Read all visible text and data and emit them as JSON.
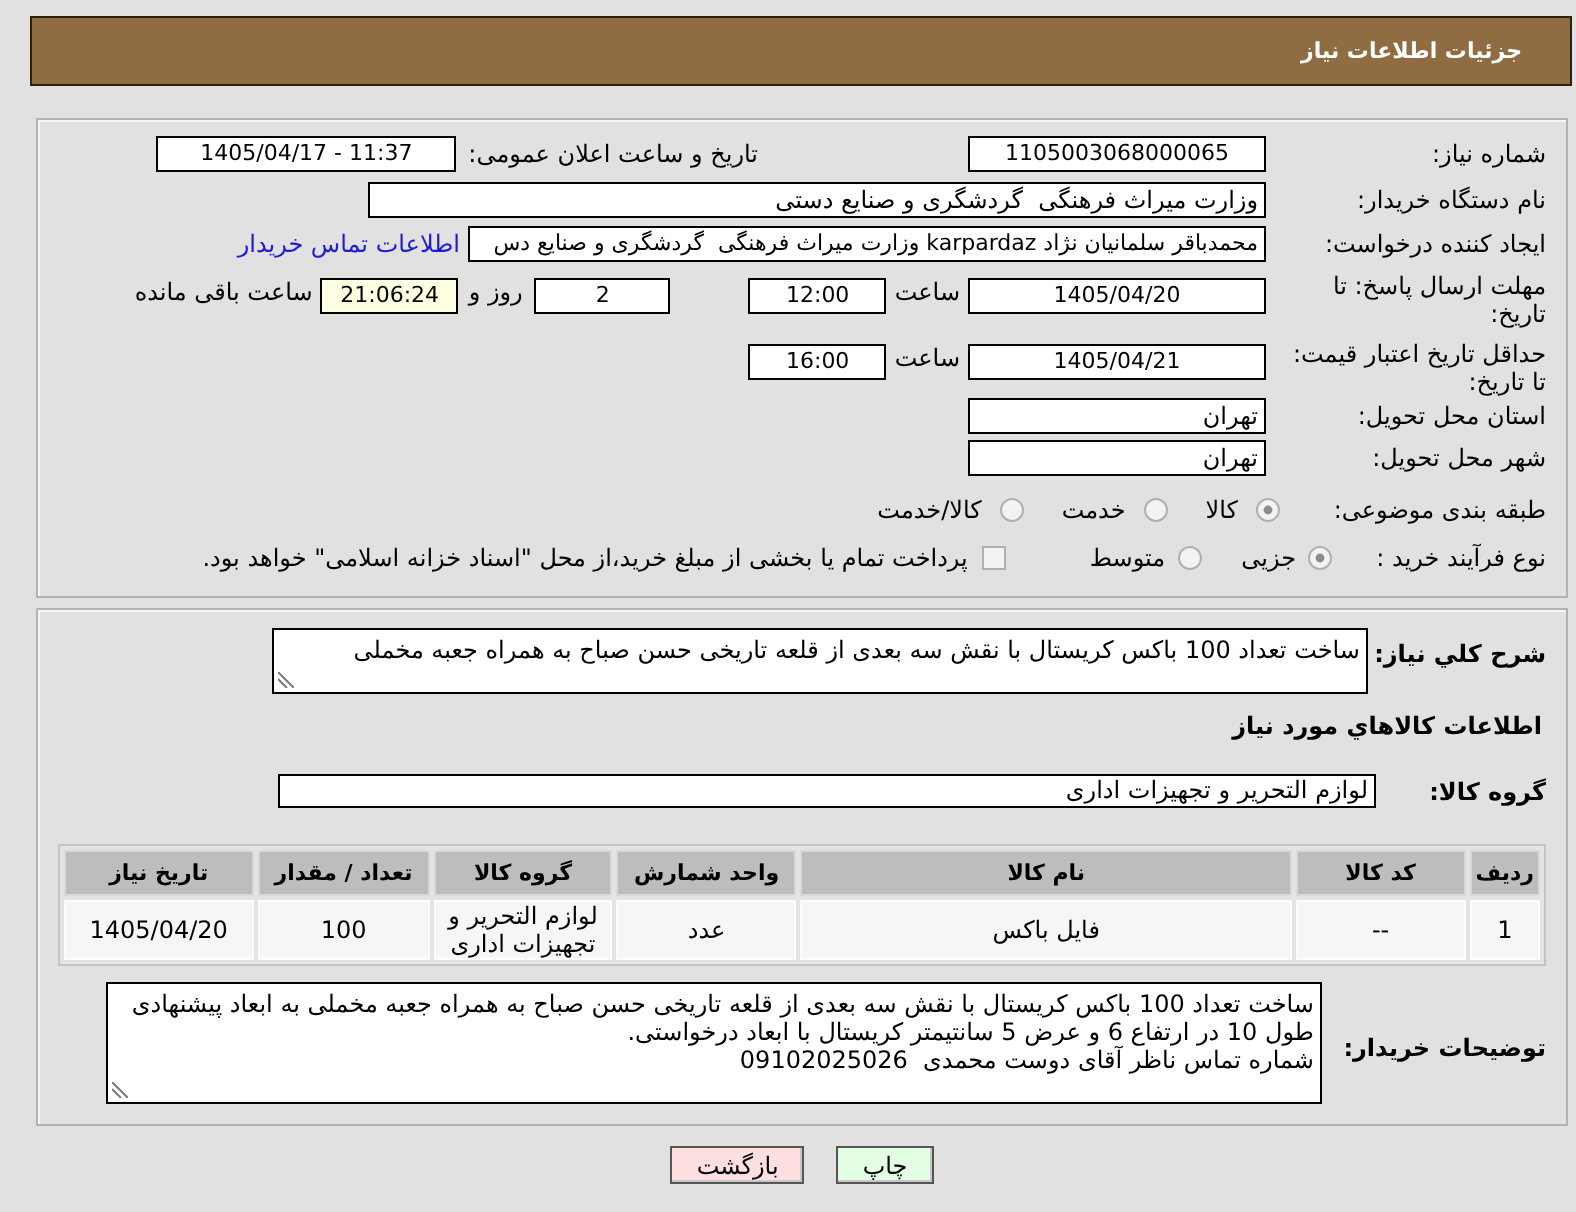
{
  "header": {
    "title": "جزئیات اطلاعات نیاز"
  },
  "need_info": {
    "need_number": {
      "label": "شماره نیاز:",
      "value": "1105003068000065"
    },
    "announce_date": {
      "label": "تاریخ و ساعت اعلان عمومی:",
      "value": "1405/04/17 - 11:37"
    },
    "buyer_org": {
      "label": "نام دستگاه خریدار:",
      "value": "وزارت میراث فرهنگی  گردشگری و صنایع دستی"
    },
    "requester": {
      "label": "ایجاد کننده درخواست:",
      "value": "محمدباقر سلمانیان نژاد karpardaz وزارت میراث فرهنگی  گردشگری و صنایع دس",
      "contact_link": "اطلاعات تماس خریدار"
    },
    "response_deadline": {
      "label": "مهلت ارسال پاسخ: تا تاریخ:",
      "date": "1405/04/20",
      "time_label": "ساعت",
      "time": "12:00",
      "days": "2",
      "days_label": "روز و",
      "remaining_time": "21:06:24",
      "remaining_label": "ساعت باقی مانده"
    },
    "price_validity": {
      "label": "حداقل تاریخ اعتبار قیمت: تا تاریخ:",
      "date": "1405/04/21",
      "time_label": "ساعت",
      "time": "16:00"
    },
    "delivery_province": {
      "label": "استان محل تحویل:",
      "value": "تهران"
    },
    "delivery_city": {
      "label": "شهر محل تحویل:",
      "value": "تهران"
    },
    "subject_category": {
      "label": "طبقه بندی موضوعی:",
      "disabled": true,
      "options": [
        {
          "label": "کالا",
          "selected": true
        },
        {
          "label": "خدمت",
          "selected": false
        },
        {
          "label": "کالا/خدمت",
          "selected": false
        }
      ]
    },
    "purchase_process": {
      "label": "نوع فرآیند خرید :",
      "disabled": true,
      "options": [
        {
          "label": "جزیی",
          "selected": true
        },
        {
          "label": "متوسط",
          "selected": false
        }
      ],
      "treasury_option": {
        "label": "پرداخت تمام یا بخشی از مبلغ خرید،از محل \"اسناد خزانه اسلامی\" خواهد بود.",
        "checked": false,
        "disabled": true
      }
    }
  },
  "description": {
    "label": "شرح کلي نیاز:",
    "text": "ساخت تعداد 100 باکس کریستال با نقش سه بعدی از قلعه تاریخی حسن صباح به همراه جعبه مخملی"
  },
  "goods": {
    "title": "اطلاعات کالاهاي مورد نیاز",
    "group_label": "گروه کالا:",
    "group_value": "لوازم التحریر و تجهیزات اداری",
    "table": {
      "columns": [
        "ردیف",
        "کد کالا",
        "نام کالا",
        "واحد شمارش",
        "گروه کالا",
        "تعداد / مقدار",
        "تاریخ نیاز"
      ],
      "rows": [
        [
          "1",
          "--",
          "فایل باکس",
          "عدد",
          "لوازم التحریر و تجهیزات اداری",
          "100",
          "1405/04/20"
        ]
      ]
    }
  },
  "buyer_notes": {
    "label": "توضیحات خریدار:",
    "paragraphs": [
      "ساخت تعداد 100 باکس کریستال با نقش سه بعدی از قلعه تاریخی حسن صباح به همراه جعبه مخملی به ابعاد پیشنهادی طول 10 در ارتفاع 6 و عرض 5 سانتیمتر کریستال با ابعاد درخواستی.",
      "شماره تماس ناظر آقای دوست محمدی  09102025026"
    ]
  },
  "buttons": [
    {
      "label": "چاپ",
      "kind": "print"
    },
    {
      "label": "بازگشت",
      "kind": "back"
    }
  ]
}
